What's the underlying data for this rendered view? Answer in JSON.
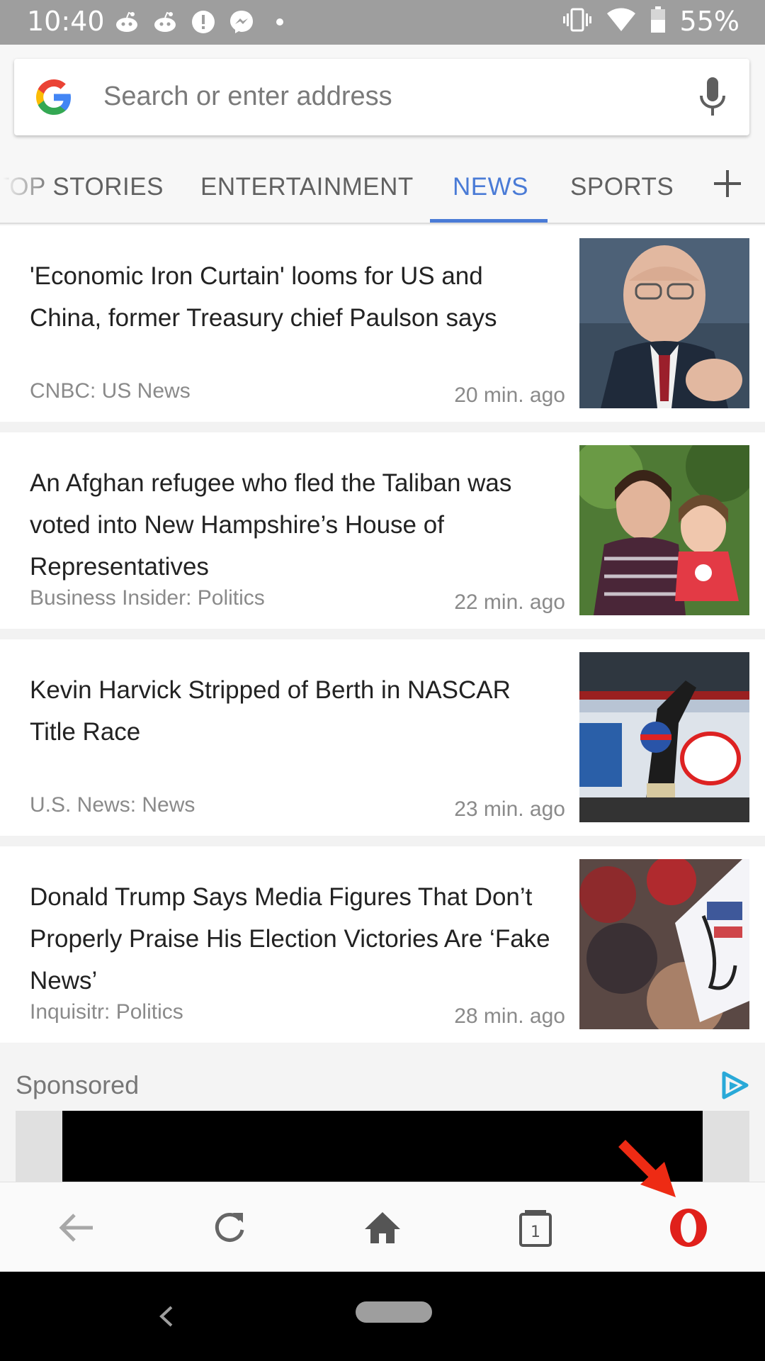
{
  "status_bar": {
    "time": "10:40",
    "battery": "55%",
    "left_icons": [
      "reddit-icon",
      "reddit-icon",
      "alert-icon",
      "messenger-icon",
      "dot-icon"
    ],
    "right_icons": [
      "vibrate-icon",
      "wifi-icon",
      "battery-icon"
    ]
  },
  "search": {
    "placeholder": "Search or enter address"
  },
  "tabs": [
    {
      "label": "TOP STORIES"
    },
    {
      "label": "ENTERTAINMENT"
    },
    {
      "label": "NEWS",
      "active": true
    },
    {
      "label": "SPORTS"
    }
  ],
  "articles": [
    {
      "title": "'Economic Iron Curtain' looms for US and China, former Treasury chief Paulson says",
      "source": "CNBC: US News",
      "time": "20 min. ago",
      "thumb": "man-with-glasses-photo"
    },
    {
      "title": "An Afghan refugee who fled the Taliban was voted into New Hampshire’s House of Representatives",
      "source": "Business Insider: Politics",
      "time": "22 min. ago",
      "thumb": "woman-with-child-photo"
    },
    {
      "title": "Kevin Harvick Stripped of Berth in NASCAR Title Race",
      "source": "U.S. News: News",
      "time": "23 min. ago",
      "thumb": "nascar-trophy-photo"
    },
    {
      "title": "Donald Trump Says Media Figures That Don’t Properly Praise His Election Victories Are ‘Fake News’",
      "source": "Inquisitr: Politics",
      "time": "28 min. ago",
      "thumb": "rally-sign-photo"
    }
  ],
  "sponsored": {
    "label": "Sponsored"
  },
  "toolbar": {
    "tab_count": "1"
  },
  "colors": {
    "accent": "#4a7bd6",
    "opera_red": "#e0201b",
    "status_bar": "#9e9e9e"
  }
}
